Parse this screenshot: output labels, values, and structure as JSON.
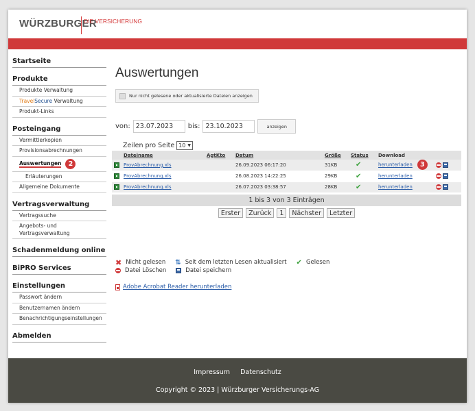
{
  "logo": {
    "main": "WÜRZBURGER",
    "sub": "DIE VERSICHERUNG"
  },
  "sidebar": {
    "startseite": "Startseite",
    "produkte": {
      "title": "Produkte",
      "items": [
        "Produkte Verwaltung",
        "Produkt-Links"
      ],
      "travel_part1": "Travel",
      "travel_part2": "Secure",
      "travel_part3": " Verwaltung"
    },
    "posteingang": {
      "title": "Posteingang",
      "items": [
        "Vermittlerkopien",
        "Provisionsabrechnungen",
        "Auswertungen",
        "Erläuterungen",
        "Allgemeine Dokumente"
      ],
      "badge": "2"
    },
    "vertragsverwaltung": {
      "title": "Vertragsverwaltung",
      "items": [
        "Vertragssuche",
        "Angebots- und",
        "Vertragsverwaltung"
      ]
    },
    "schadenmeldung": "Schadenmeldung online",
    "bipro": "BiPRO Services",
    "einstellungen": {
      "title": "Einstellungen",
      "items": [
        "Passwort ändern",
        "Benutzernamen ändern",
        "Benachrichtigungseinstellungen"
      ]
    },
    "abmelden": "Abmelden"
  },
  "main": {
    "title": "Auswertungen",
    "filter_label": "Nur nicht gelesene oder aktualisierte Dateien anzeigen",
    "von_label": "von:",
    "von_value": "23.07.2023",
    "bis_label": "bis:",
    "bis_value": "23.10.2023",
    "anzeigen_label": "anzeigen",
    "zeilen_label": "Zeilen pro Seite",
    "zeilen_value": "10",
    "table": {
      "headers": [
        "Dateiname",
        "AgtKto",
        "Datum",
        "Größe",
        "Status",
        "Download"
      ],
      "rows": [
        {
          "file": "ProvAbrechnung.xls",
          "agtkto": "",
          "datum": "26.09.2023 06:17:20",
          "size": "31KB",
          "download": "herunterladen"
        },
        {
          "file": "ProvAbrechnung.xls",
          "agtkto": "",
          "datum": "26.08.2023 14:22:25",
          "size": "29KB",
          "download": "herunterladen"
        },
        {
          "file": "ProvAbrechnung.xls",
          "agtkto": "",
          "datum": "26.07.2023 03:38:57",
          "size": "28KB",
          "download": "herunterladen"
        }
      ],
      "badge": "3"
    },
    "pager_info": "1 bis 3 von 3 Einträgen",
    "pager": {
      "first": "Erster",
      "prev": "Zurück",
      "page": "1",
      "next": "Nächster",
      "last": "Letzter"
    },
    "legend": {
      "unread": "Nicht gelesen",
      "updated": "Seit dem letzten Lesen aktualisiert",
      "read": "Gelesen",
      "delete": "Datei Löschen",
      "save": "Datei speichern"
    },
    "adobe_link": "Adobe Acrobat Reader herunterladen"
  },
  "footer": {
    "impressum": "Impressum",
    "datenschutz": "Datenschutz",
    "copyright": "Copyright © 2023 | Würzburger Versicherungs-AG"
  },
  "colors": {
    "brand_red": "#d0393a",
    "footer_bg": "#4a4a43",
    "link_blue": "#2a5ca8"
  }
}
